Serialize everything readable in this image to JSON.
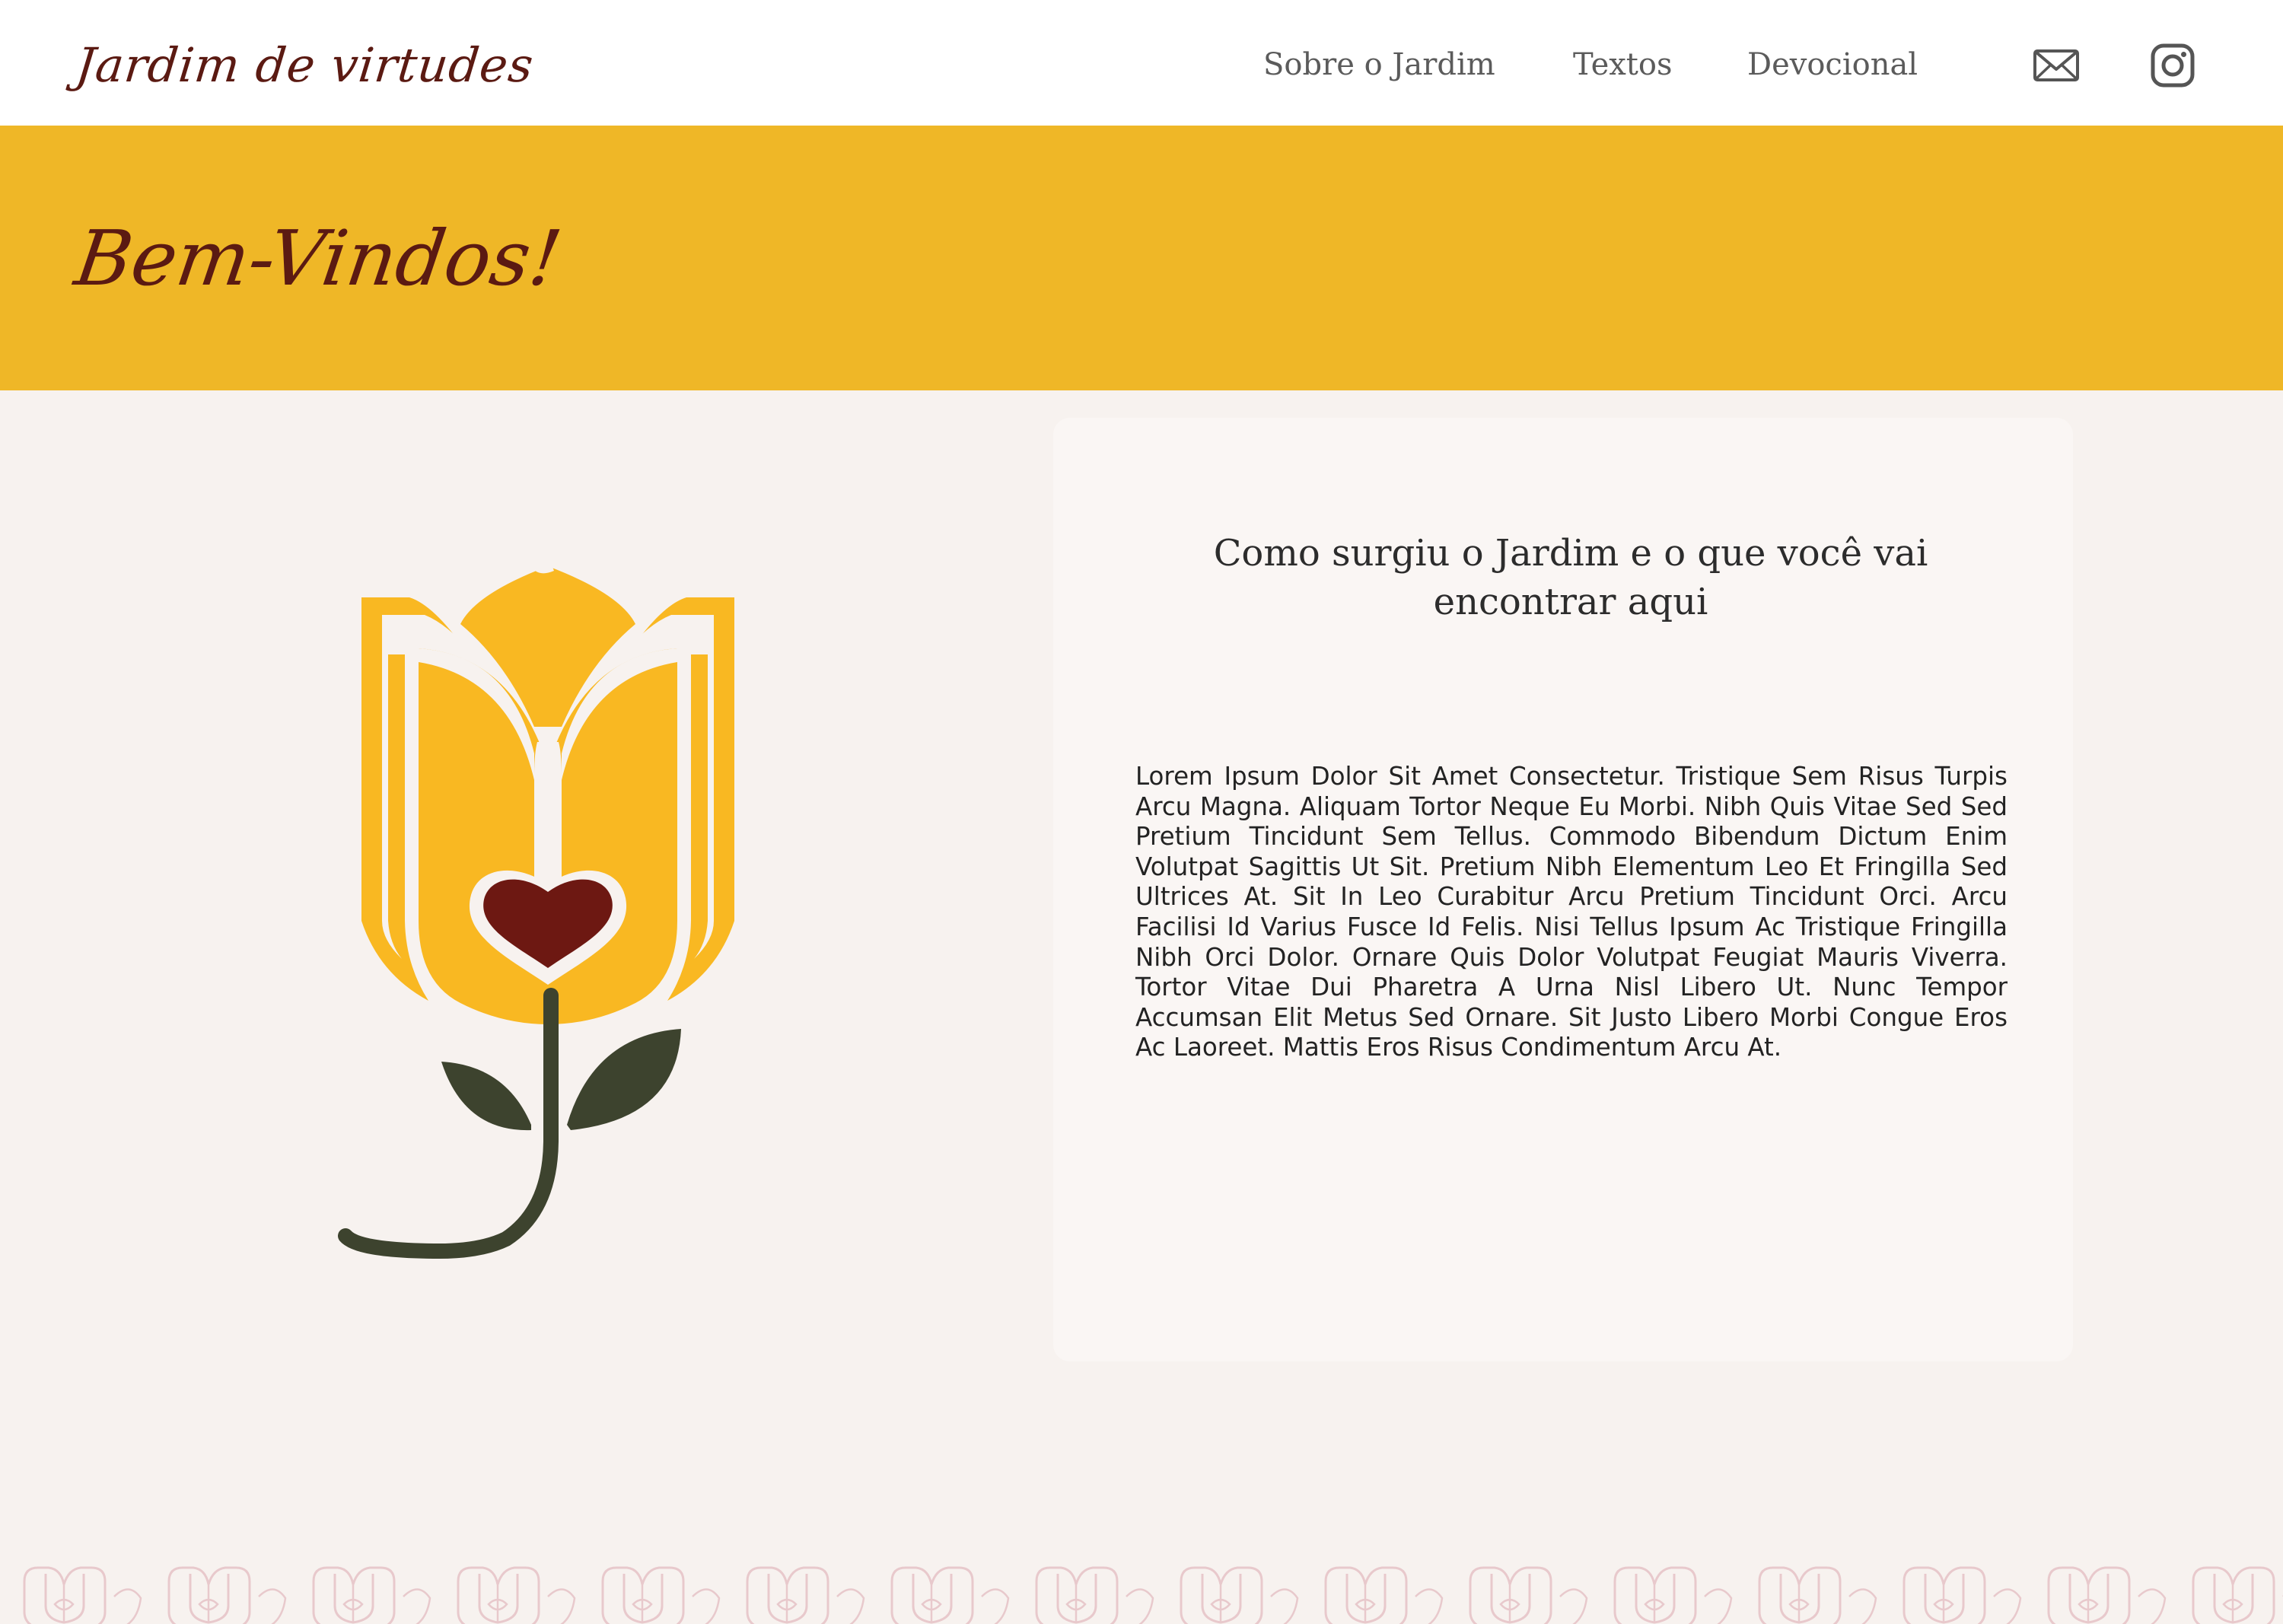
{
  "header": {
    "brand": "Jardim de virtudes",
    "nav": [
      "Sobre o Jardim",
      "Textos",
      "Devocional"
    ],
    "icons": [
      "mail-icon",
      "instagram-icon"
    ]
  },
  "banner": {
    "title": "Bem-Vindos!",
    "color": "#efb727"
  },
  "card": {
    "title": "Como surgiu o Jardim e o que você vai encontrar aqui",
    "body": "Lorem Ipsum Dolor Sit Amet Consectetur. Tristique Sem Risus Turpis Arcu Magna. Aliquam Tortor Neque Eu Morbi. Nibh Quis Vitae Sed Sed Pretium Tincidunt Sem Tellus. Commodo Bibendum Dictum Enim Volutpat Sagittis Ut Sit. Pretium Nibh Elementum Leo Et Fringilla Sed Ultrices At. Sit In Leo Curabitur Arcu Pretium Tincidunt Orci. Arcu Facilisi Id Varius Fusce Id Felis. Nisi Tellus Ipsum Ac Tristique Fringilla Nibh Orci Dolor. Ornare Quis Dolor Volutpat Feugiat Mauris Viverra. Tortor Vitae Dui Pharetra A Urna Nisl Libero Ut. Nunc Tempor Accumsan Elit Metus Sed Ornare. Sit Justo Libero Morbi Congue Eros Ac Laoreet. Mattis Eros Risus Condimentum Arcu At."
  },
  "colors": {
    "brand": "#5b1a12",
    "petal": "#f9b822",
    "heart": "#6d1812",
    "leaf": "#3d432e",
    "page": "#f7f2ef",
    "pattern": "#e8c9cc"
  }
}
